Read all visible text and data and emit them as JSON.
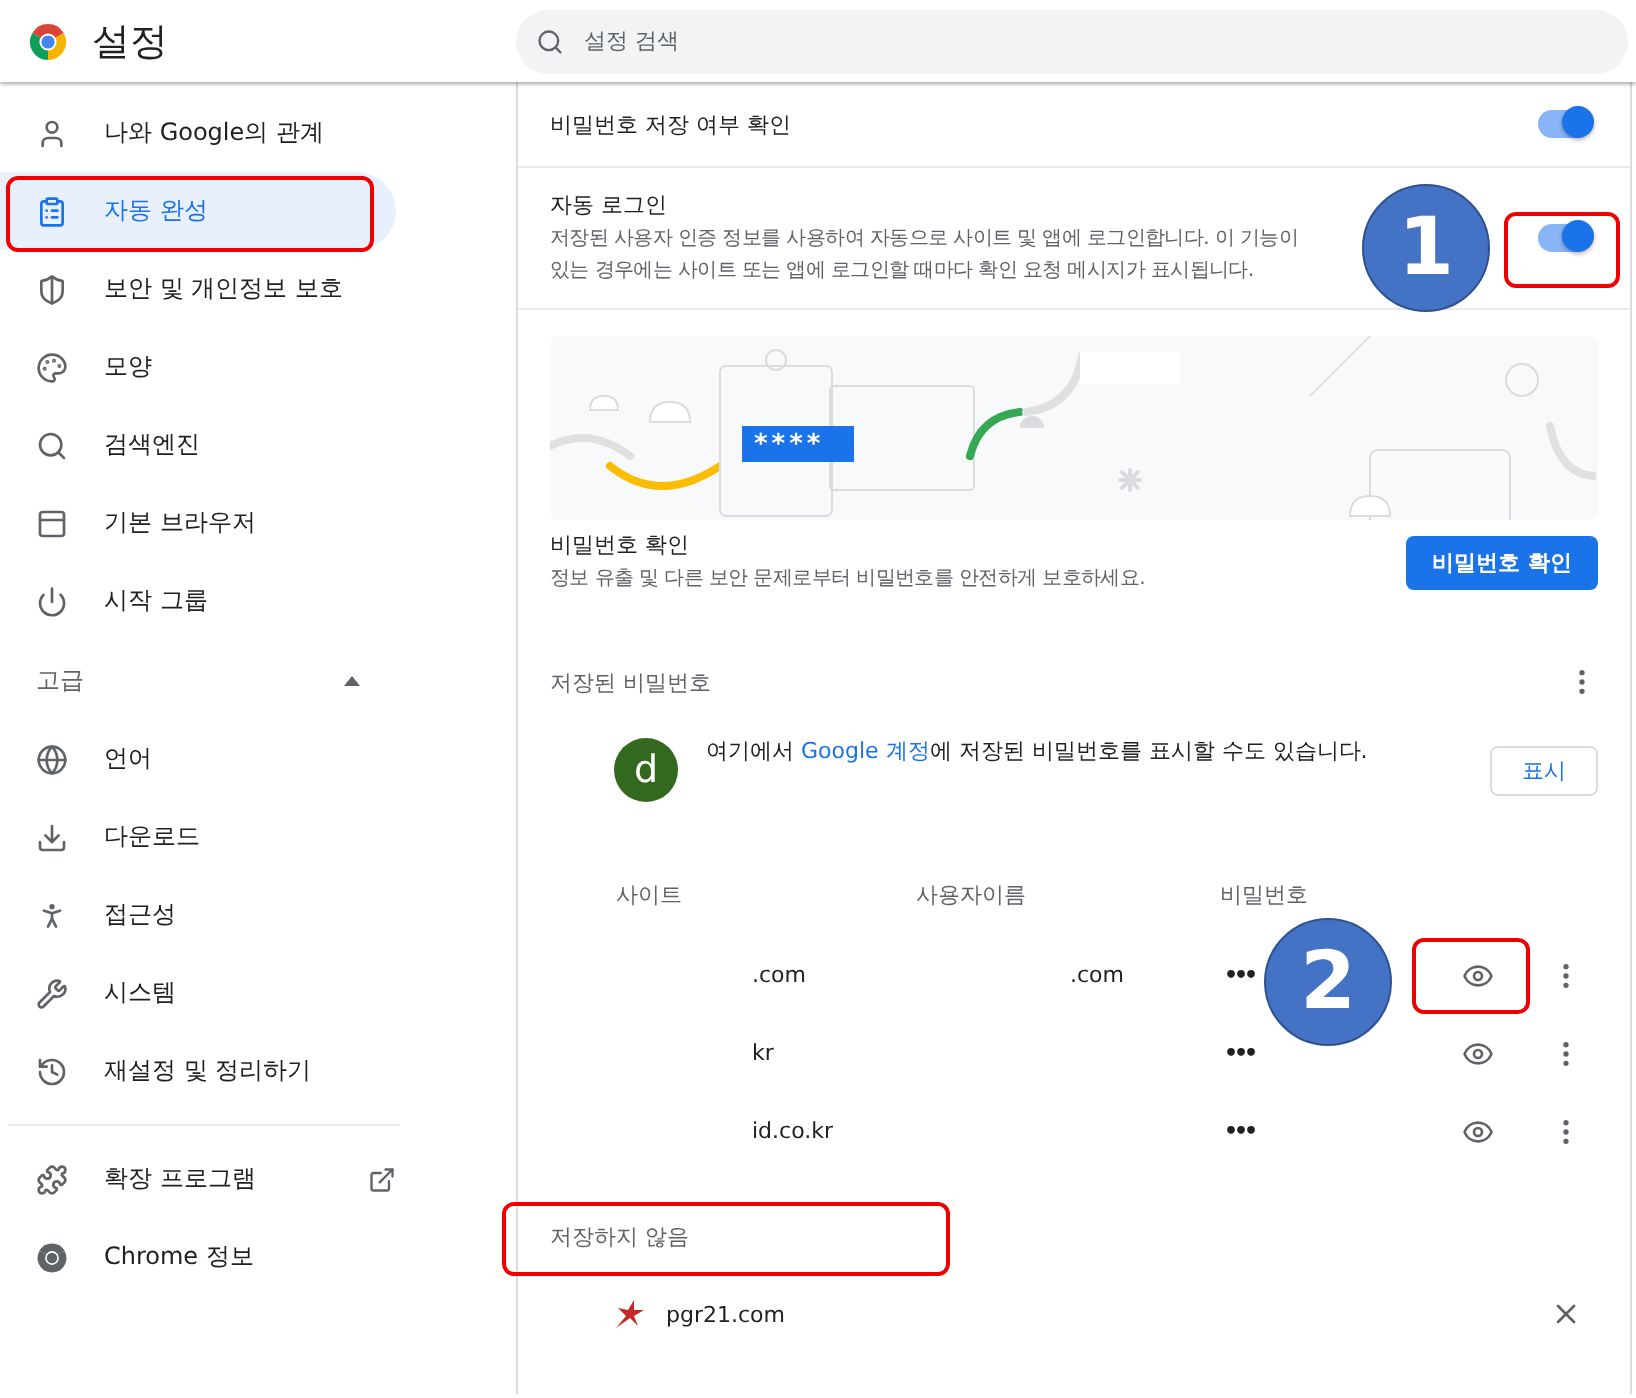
{
  "header": {
    "title": "설정",
    "search": {
      "placeholder": "설정 검색"
    }
  },
  "sidebar": {
    "items": [
      {
        "label": "나와 Google의 관계",
        "selected": false
      },
      {
        "label": "자동 완성",
        "selected": true
      },
      {
        "label": "보안 및 개인정보 보호",
        "selected": false
      },
      {
        "label": "모양",
        "selected": false
      },
      {
        "label": "검색엔진",
        "selected": false
      },
      {
        "label": "기본 브라우저",
        "selected": false
      },
      {
        "label": "시작 그룹",
        "selected": false
      }
    ],
    "advanced": {
      "label": "고급",
      "expanded": true,
      "items": [
        {
          "label": "언어",
          "selected": false
        },
        {
          "label": "다운로드",
          "selected": false
        },
        {
          "label": "접근성",
          "selected": false
        },
        {
          "label": "시스템",
          "selected": false
        },
        {
          "label": "재설정 및 정리하기",
          "selected": false
        }
      ]
    },
    "extra_items": [
      {
        "label": "확장 프로그램",
        "external": true
      },
      {
        "label": "Chrome 정보",
        "external": false
      }
    ]
  },
  "settings": [
    {
      "label": "비밀번호 저장 여부 확인",
      "on": true
    },
    {
      "label": "자동 로그인",
      "description_lines": [
        "저장된 사용자 인증 정보를 사용하여 자동으로 사이트 및 앱에 로그인합니다. 이 기능이",
        "있는 경우에는 사이트 또는 앱에 로그인할 때마다 확인 요청 메시지가 표시됩니다."
      ],
      "on": true
    }
  ],
  "illustration": {
    "masked_text": "****"
  },
  "password_check": {
    "title": "비밀번호 확인",
    "description": "정보 유출 및 다른 보안 문제로부터 비밀번호를 안전하게 보호하세요.",
    "button": "비밀번호 확인"
  },
  "saved_passwords": {
    "title": "저장된 비밀번호",
    "account": {
      "avatar": "d",
      "text_before": "여기에서 ",
      "link": "Google 계정",
      "text_after": "에 저장된 비밀번호를 표시할 수도 있습니다.",
      "button": "표시"
    },
    "columns": [
      "사이트",
      "사용자이름",
      "비밀번호"
    ],
    "rows": [
      {
        "site": ".com",
        "username": ".com",
        "password": "•••"
      },
      {
        "site": "kr",
        "password": "•••"
      },
      {
        "site": "id.co.kr",
        "password": "•••"
      }
    ]
  },
  "never_saved": {
    "title": "저장하지 않음",
    "sites": [
      {
        "site": "pgr21.com"
      }
    ]
  },
  "annotations": {
    "badges": [
      "1",
      "2"
    ]
  }
}
